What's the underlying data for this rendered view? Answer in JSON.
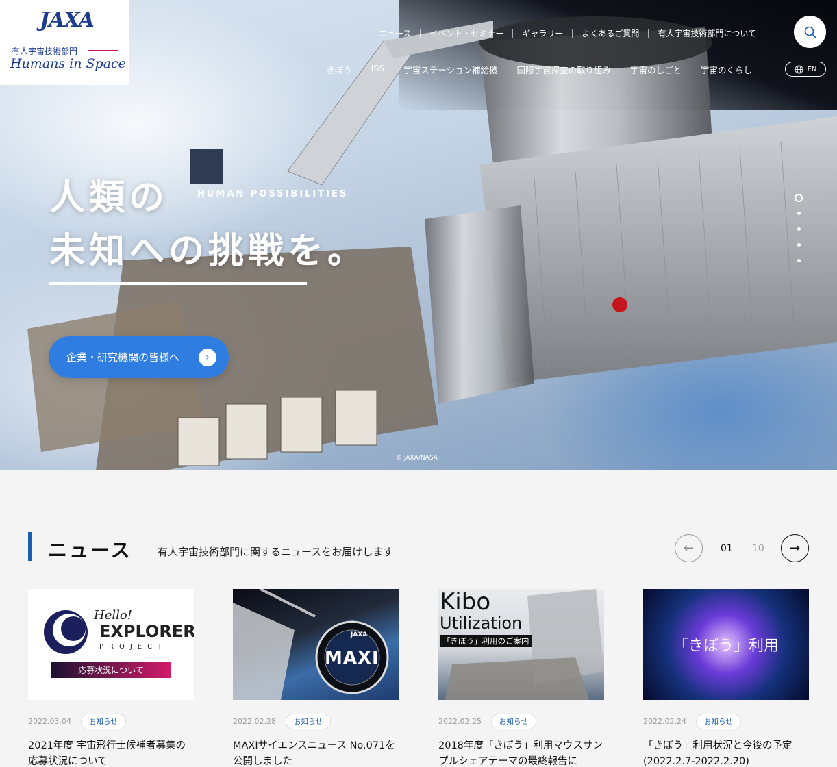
{
  "brand": {
    "logo_text": "JAXA",
    "dept_ja": "有人宇宙技術部門",
    "dept_en": "Humans in Space"
  },
  "top_nav": [
    "ニュース",
    "イベント・セミナー",
    "ギャラリー",
    "よくあるご質問",
    "有人宇宙技術部門について"
  ],
  "main_nav": [
    "きぼう",
    "ISS",
    "宇宙ステーション補給機",
    "国際宇宙探査の取り組み",
    "宇宙のしごと",
    "宇宙のくらし"
  ],
  "lang_label": "EN",
  "hero": {
    "title_line1": "人類の",
    "title_line2": "未知への挑戦を。",
    "subtitle": "HUMAN POSSIBILITIES",
    "cta_label": "企業・研究機関の皆様へ",
    "credit": "© JAXA/NASA",
    "slide_count": 5,
    "active_slide": 1
  },
  "news": {
    "heading": "ニュース",
    "description": "有人宇宙技術部門に関するニュースをお届けします",
    "page_current": "01",
    "page_total": "10",
    "items": [
      {
        "date": "2022.03.04",
        "tag": "お知らせ",
        "title": "2021年度 宇宙飛行士候補者募集の応募状況について",
        "thumb_hello": "Hello!",
        "thumb_main": "EXPLORERS",
        "thumb_project": "PROJECT",
        "thumb_banner": "応募状況について"
      },
      {
        "date": "2022.02.28",
        "tag": "お知らせ",
        "title": "MAXIサイエンスニュース No.071を公開しました",
        "thumb_badge": "MAXI",
        "thumb_badge_top": "JAXA"
      },
      {
        "date": "2022.02.25",
        "tag": "お知らせ",
        "title": "2018年度「きぼう」利用マウスサンプルシェアテーマの最終報告に",
        "thumb_line1": "Kibo",
        "thumb_line2": "Utilization",
        "thumb_label": "「きぼう」利用のご案内"
      },
      {
        "date": "2022.02.24",
        "tag": "お知らせ",
        "title": "「きぼう」利用状況と今後の予定(2022.2.7-2022.2.20)",
        "thumb_text": "「きぼう」利用"
      }
    ]
  }
}
